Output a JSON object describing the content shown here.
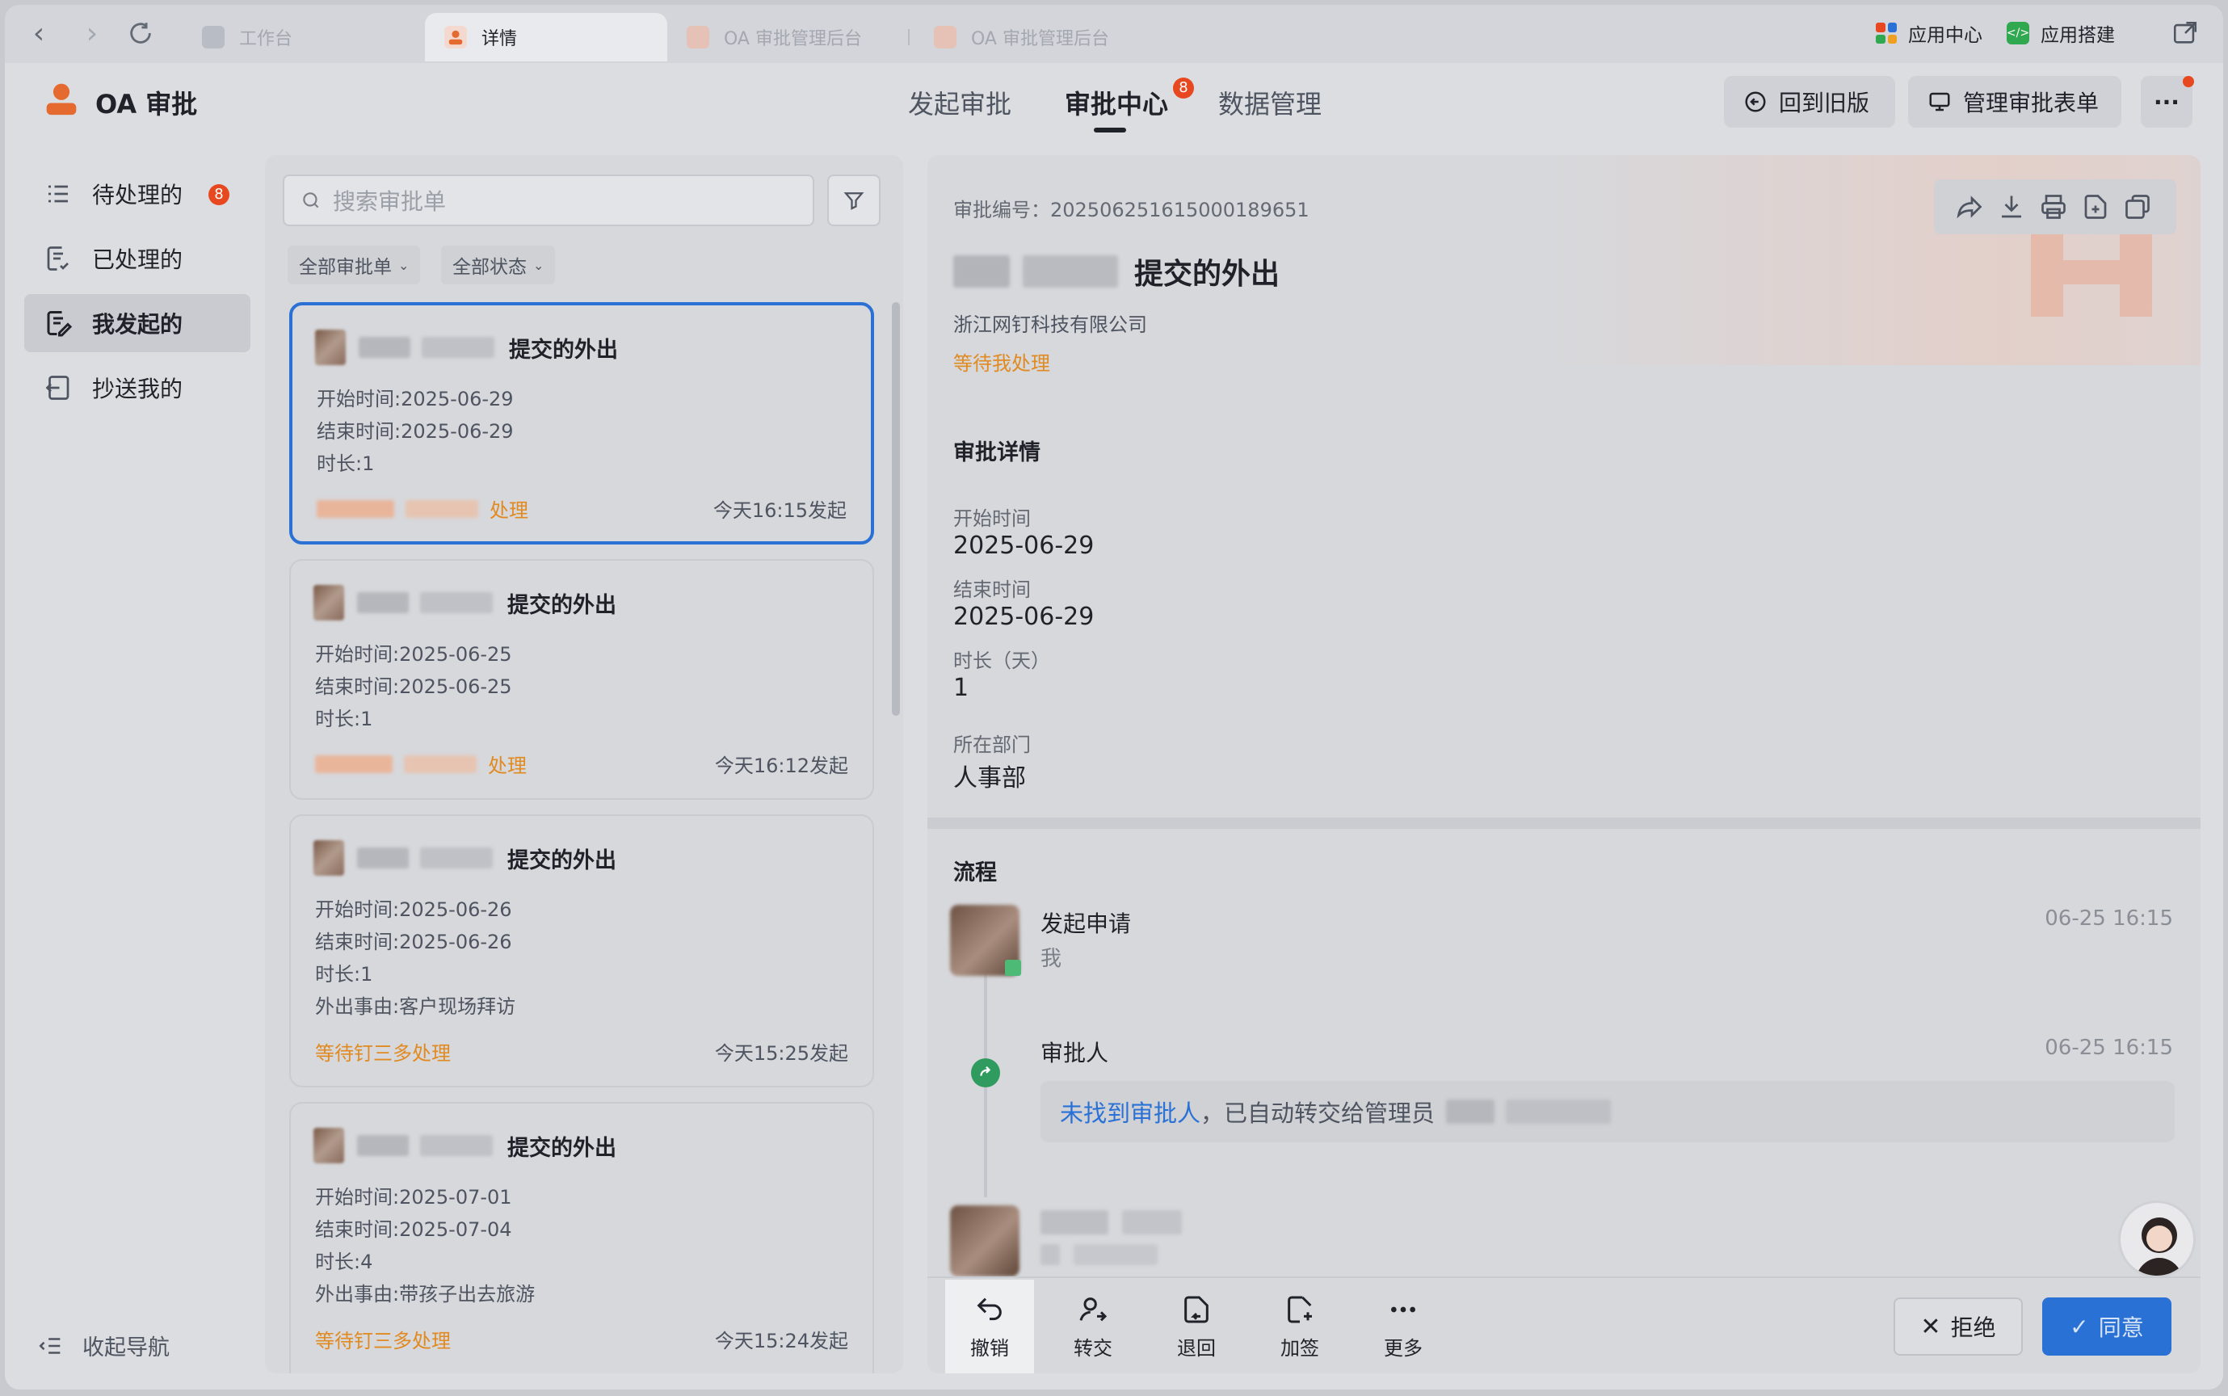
{
  "browser": {
    "tabs": [
      {
        "label": "工作台",
        "active": false
      },
      {
        "label": "详情",
        "active": true
      },
      {
        "label": "OA 审批管理后台",
        "active": false
      },
      {
        "label": "OA 审批管理后台",
        "active": false
      }
    ],
    "app_center": "应用中心",
    "app_builder": "应用搭建"
  },
  "header": {
    "app_title": "OA 审批",
    "tabs": [
      {
        "label": "发起审批"
      },
      {
        "label": "审批中心",
        "badge": "8",
        "active": true
      },
      {
        "label": "数据管理"
      }
    ],
    "back_old_label": "回到旧版",
    "manage_forms_label": "管理审批表单",
    "more_label": "···"
  },
  "sidebar": {
    "items": [
      {
        "label": "待处理的",
        "badge": "8"
      },
      {
        "label": "已处理的"
      },
      {
        "label": "我发起的",
        "active": true
      },
      {
        "label": "抄送我的"
      }
    ],
    "collapse_label": "收起导航"
  },
  "list": {
    "search_placeholder": "搜索审批单",
    "filter_all_forms": "全部审批单",
    "filter_all_status": "全部状态",
    "cards": [
      {
        "title": "提交的外出",
        "lines": [
          "开始时间:2025-06-29",
          "结束时间:2025-06-29",
          "时长:1"
        ],
        "status": "处理",
        "time": "今天16:15发起",
        "selected": true
      },
      {
        "title": "提交的外出",
        "lines": [
          "开始时间:2025-06-25",
          "结束时间:2025-06-25",
          "时长:1"
        ],
        "status": "处理",
        "time": "今天16:12发起"
      },
      {
        "title": "提交的外出",
        "lines": [
          "开始时间:2025-06-26",
          "结束时间:2025-06-26",
          "时长:1",
          "外出事由:客户现场拜访"
        ],
        "status": "等待钉三多处理",
        "time": "今天15:25发起"
      },
      {
        "title": "提交的外出",
        "lines": [
          "开始时间:2025-07-01",
          "结束时间:2025-07-04",
          "时长:4",
          "外出事由:带孩子出去旅游"
        ],
        "status": "等待钉三多处理",
        "time": "今天15:24发起"
      }
    ]
  },
  "detail": {
    "approval_no": "审批编号：202506251615000189651",
    "title": "提交的外出",
    "company": "浙江网钉科技有限公司",
    "status": "等待我处理",
    "section_details": "审批详情",
    "fields": [
      {
        "label": "开始时间",
        "value": "2025-06-29"
      },
      {
        "label": "结束时间",
        "value": "2025-06-29"
      },
      {
        "label": "时长（天）",
        "value": "1"
      },
      {
        "label": "所在部门",
        "value": "人事部"
      }
    ],
    "section_flow": "流程",
    "flow": [
      {
        "title": "发起申请",
        "sub": "我",
        "time": "06-25 16:15"
      },
      {
        "title": "审批人",
        "time": "06-25 16:15",
        "note_link": "未找到审批人",
        "note_text": "，已自动转交给管理员"
      }
    ],
    "actions": [
      {
        "label": "撤销",
        "icon": "undo-icon"
      },
      {
        "label": "转交",
        "icon": "transfer-icon"
      },
      {
        "label": "退回",
        "icon": "return-icon"
      },
      {
        "label": "加签",
        "icon": "add-sign-icon"
      },
      {
        "label": "更多",
        "icon": "more-icon"
      }
    ],
    "reject_label": "拒绝",
    "approve_label": "同意"
  },
  "colors": {
    "accent": "#2a71d6",
    "badge": "#e8481f",
    "status_orange": "#e08a21"
  }
}
